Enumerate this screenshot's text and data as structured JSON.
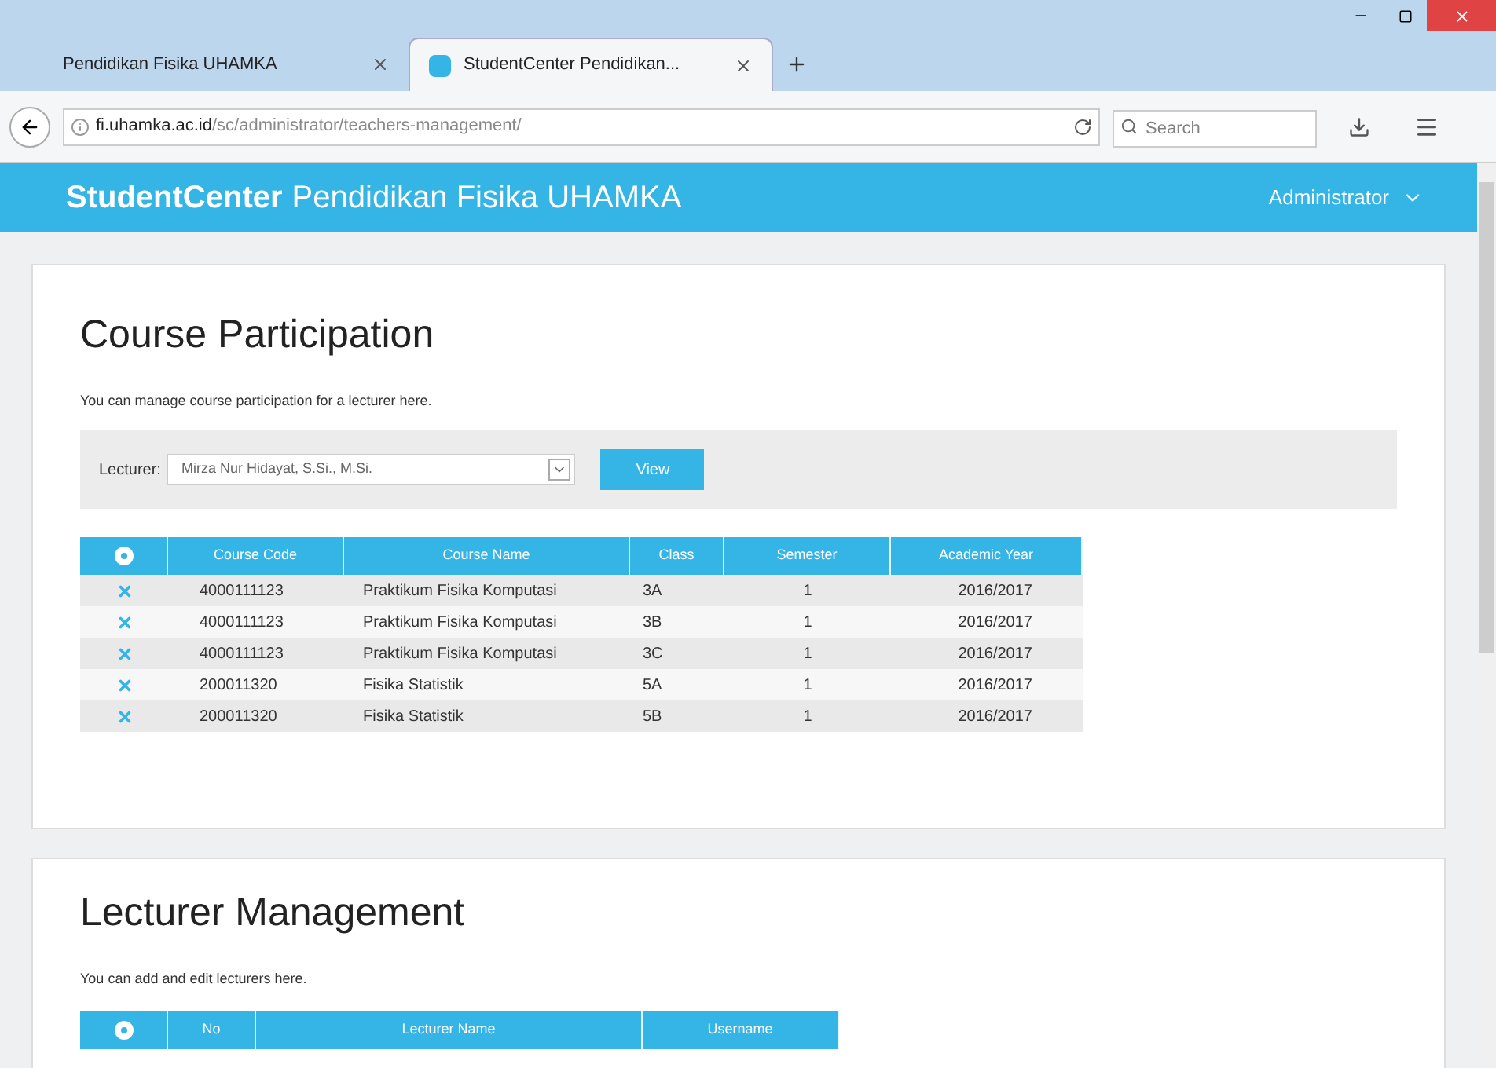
{
  "browser": {
    "tabs": [
      {
        "label": "Pendidikan Fisika UHAMKA",
        "selected": false
      },
      {
        "label": "StudentCenter Pendidikan...",
        "selected": true
      }
    ],
    "url_host": "fi.uhamka.ac.id",
    "url_path": "/sc/administrator/teachers-management/",
    "search": {
      "placeholder": "Search"
    }
  },
  "header": {
    "brand": "StudentCenter",
    "title": "Pendidikan Fisika UHAMKA",
    "user": "Administrator"
  },
  "course_participation": {
    "title": "Course Participation",
    "description": "You can manage course participation for a lecturer here.",
    "lecturer_label": "Lecturer:",
    "lecturer_value": "Mirza Nur Hidayat, S.Si., M.Si.",
    "view_button": "View",
    "columns": [
      "Course Code",
      "Course Name",
      "Class",
      "Semester",
      "Academic Year"
    ],
    "rows": [
      [
        "4000111123",
        "Praktikum Fisika Komputasi",
        "3A",
        "1",
        "2016/2017"
      ],
      [
        "4000111123",
        "Praktikum Fisika Komputasi",
        "3B",
        "1",
        "2016/2017"
      ],
      [
        "4000111123",
        "Praktikum Fisika Komputasi",
        "3C",
        "1",
        "2016/2017"
      ],
      [
        "200011320",
        "Fisika Statistik",
        "5A",
        "1",
        "2016/2017"
      ],
      [
        "200011320",
        "Fisika Statistik",
        "5B",
        "1",
        "2016/2017"
      ]
    ]
  },
  "lecturer_management": {
    "title": "Lecturer Management",
    "description": "You can add and edit lecturers here.",
    "columns": [
      "No",
      "Lecturer Name",
      "Username"
    ]
  }
}
